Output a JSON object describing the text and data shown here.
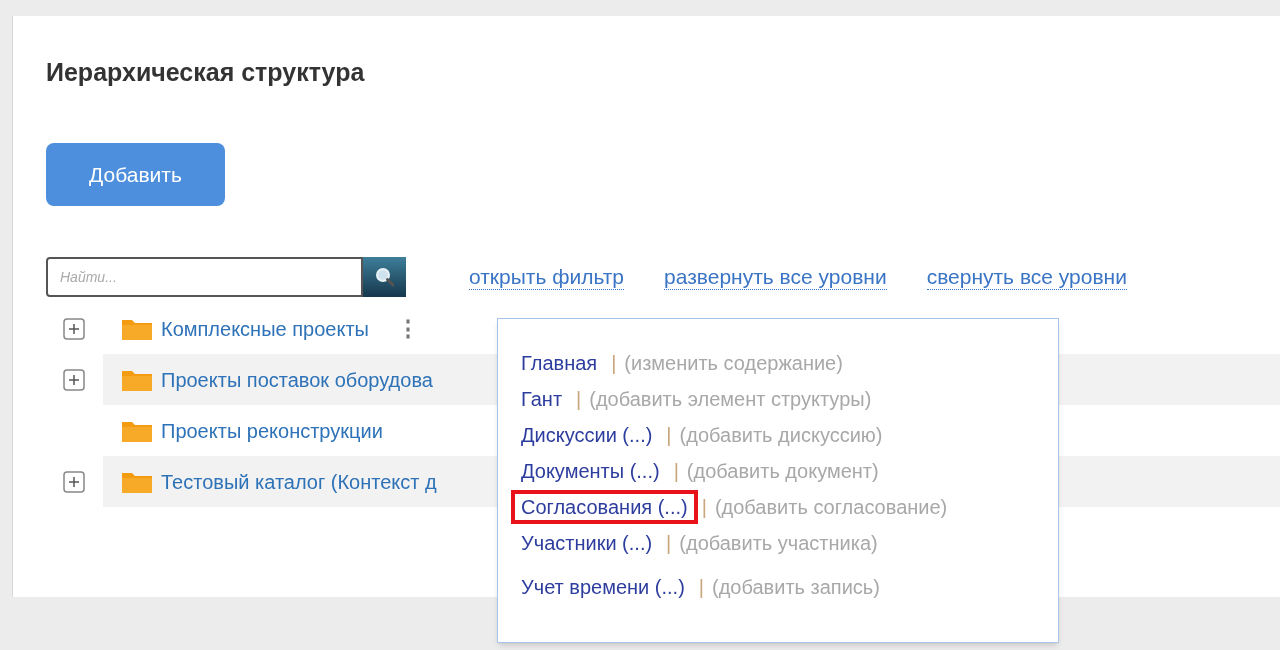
{
  "panel": {
    "title": "Иерархическая структура",
    "add_button": "Добавить"
  },
  "search": {
    "placeholder": "Найти..."
  },
  "tree_links": [
    "открыть фильтр",
    "развернуть все уровни",
    "свернуть все уровни"
  ],
  "tree": [
    {
      "label": "Комплексные проекты",
      "expandable": true,
      "striped": false,
      "menu": "⋮"
    },
    {
      "label": "Проекты поставок оборудова",
      "expandable": true,
      "striped": true
    },
    {
      "label": "Проекты реконструкции",
      "expandable": false,
      "striped": false
    },
    {
      "label": "Тестовый каталог (Контекст д",
      "expandable": true,
      "striped": true
    }
  ],
  "popup_menu": [
    {
      "link": "Главная",
      "separator": "|",
      "action": "(изменить содержание)",
      "highlighted": false
    },
    {
      "link": "Гант",
      "separator": "|",
      "action": "(добавить элемент структуры)",
      "highlighted": false
    },
    {
      "link": "Дискуссии (...)",
      "separator": "|",
      "action": "(добавить дискуссию)",
      "highlighted": false
    },
    {
      "link": "Документы (...)",
      "separator": "|",
      "action": "(добавить документ)",
      "highlighted": false
    },
    {
      "link": "Согласования (...)",
      "separator": "|",
      "action": "(добавить согласование)",
      "highlighted": true
    },
    {
      "link": "Участники (...)",
      "separator": "|",
      "action": "(добавить участника)",
      "highlighted": false
    },
    {
      "link": "Учет времени (...)",
      "separator": "|",
      "action": "(добавить запись)",
      "highlighted": false
    }
  ]
}
